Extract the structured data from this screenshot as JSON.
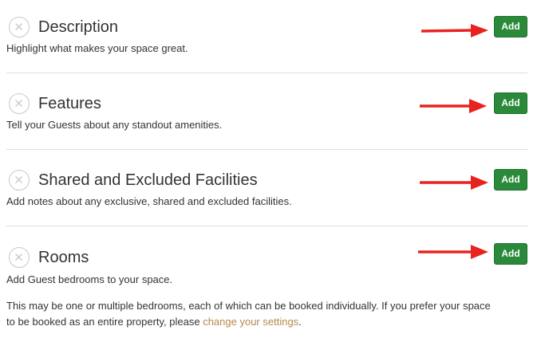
{
  "sections": [
    {
      "title": "Description",
      "description": "Highlight what makes your space great.",
      "button_label": "Add"
    },
    {
      "title": "Features",
      "description": "Tell your Guests about any standout amenities.",
      "button_label": "Add"
    },
    {
      "title": "Shared and Excluded Facilities",
      "description": "Add notes about any exclusive, shared and excluded facilities.",
      "button_label": "Add"
    },
    {
      "title": "Rooms",
      "description": "Add Guest bedrooms to your space.",
      "button_label": "Add"
    }
  ],
  "rooms_note": {
    "text_before": "This may be one or multiple bedrooms, each of which can be booked individually. If you prefer your space to be booked as an entire property, please ",
    "link_text": "change your settings",
    "text_after": "."
  },
  "icons": {
    "status": "circle-x-icon",
    "annotation": "red-arrow-icon"
  },
  "colors": {
    "button": "#2a8a3a",
    "arrow": "#e8231f",
    "link": "#b3894a"
  }
}
